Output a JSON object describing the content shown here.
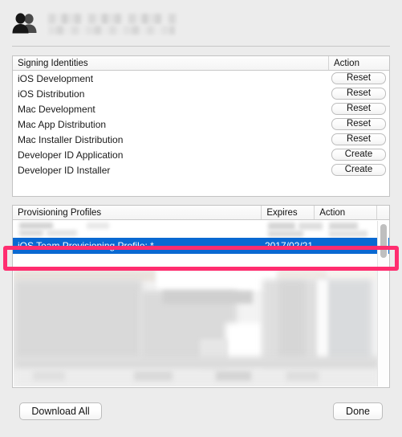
{
  "header": {
    "icon": "team-people-icon",
    "team_name_redacted": true,
    "team_id_redacted": true
  },
  "signing_identities": {
    "columns": [
      "Signing Identities",
      "Action"
    ],
    "rows": [
      {
        "name": "iOS Development",
        "action": "Reset"
      },
      {
        "name": "iOS Distribution",
        "action": "Reset"
      },
      {
        "name": "Mac Development",
        "action": "Reset"
      },
      {
        "name": "Mac App Distribution",
        "action": "Reset"
      },
      {
        "name": "Mac Installer Distribution",
        "action": "Reset"
      },
      {
        "name": "Developer ID Application",
        "action": "Create"
      },
      {
        "name": "Developer ID Installer",
        "action": "Create"
      }
    ]
  },
  "provisioning_profiles": {
    "columns": [
      "Provisioning Profiles",
      "Expires",
      "Action"
    ],
    "selected_row": {
      "name": "iOS Team Provisioning Profile: *",
      "expires": "2017/02/21",
      "action": ""
    },
    "redacted_rows_above": 1,
    "redacted_rows_below": 6,
    "scrollbar_visible": true
  },
  "annotation": {
    "highlight_color": "#ff2d6f",
    "target": "selected-provisioning-profile-row"
  },
  "footer": {
    "download_all_label": "Download All",
    "done_label": "Done"
  },
  "colors": {
    "window_background": "#ececec",
    "selection_blue": "#0a69d2",
    "highlight_pink": "#ff2d6f",
    "panel_border": "#c3c3c3"
  }
}
